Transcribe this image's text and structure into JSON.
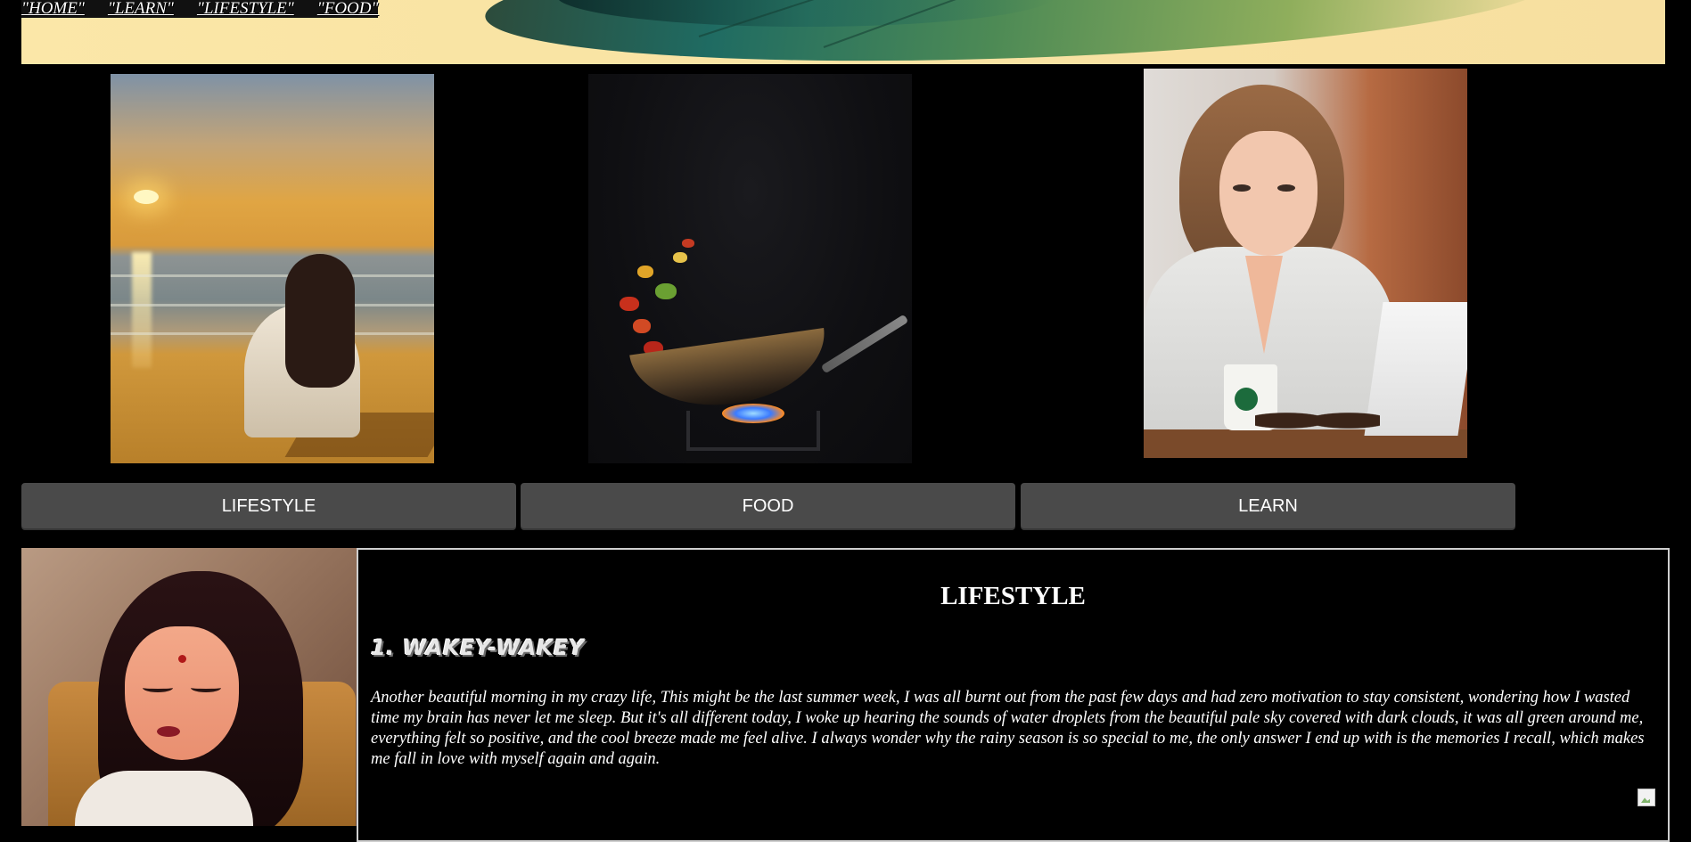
{
  "nav": {
    "links": [
      "\"HOME\"",
      "\"LEARN\"",
      "\"LIFESTYLE\"",
      "\"FOOD\""
    ]
  },
  "gallery": {
    "images": [
      {
        "name": "sunset-beach-girl-image"
      },
      {
        "name": "wok-flame-food-image"
      },
      {
        "name": "girl-laptop-cafe-image"
      }
    ]
  },
  "categories": {
    "buttons": [
      "LIFESTYLE",
      "FOOD",
      "LEARN"
    ]
  },
  "article": {
    "title": "LIFESTYLE",
    "heading": "1. WAKEY-WAKEY",
    "body": "Another beautiful morning in my crazy life, This might be the last summer week, I was all burnt out from the past few days and had zero motivation to stay consistent, wondering how I wasted time my brain has never let me sleep. But it's all different today, I woke up hearing the sounds of water droplets from the beautiful pale sky covered with dark clouds, it was all green around me, everything felt so positive, and the cool breeze made me feel alive. I always wonder why the rainy season is so special to me, the only answer I end up with is the memories I recall, which makes me fall in love with myself again and again."
  },
  "colors": {
    "background": "#000000",
    "banner": "#fbe7a8",
    "button": "#4a4a4a",
    "text": "#ffffff"
  }
}
